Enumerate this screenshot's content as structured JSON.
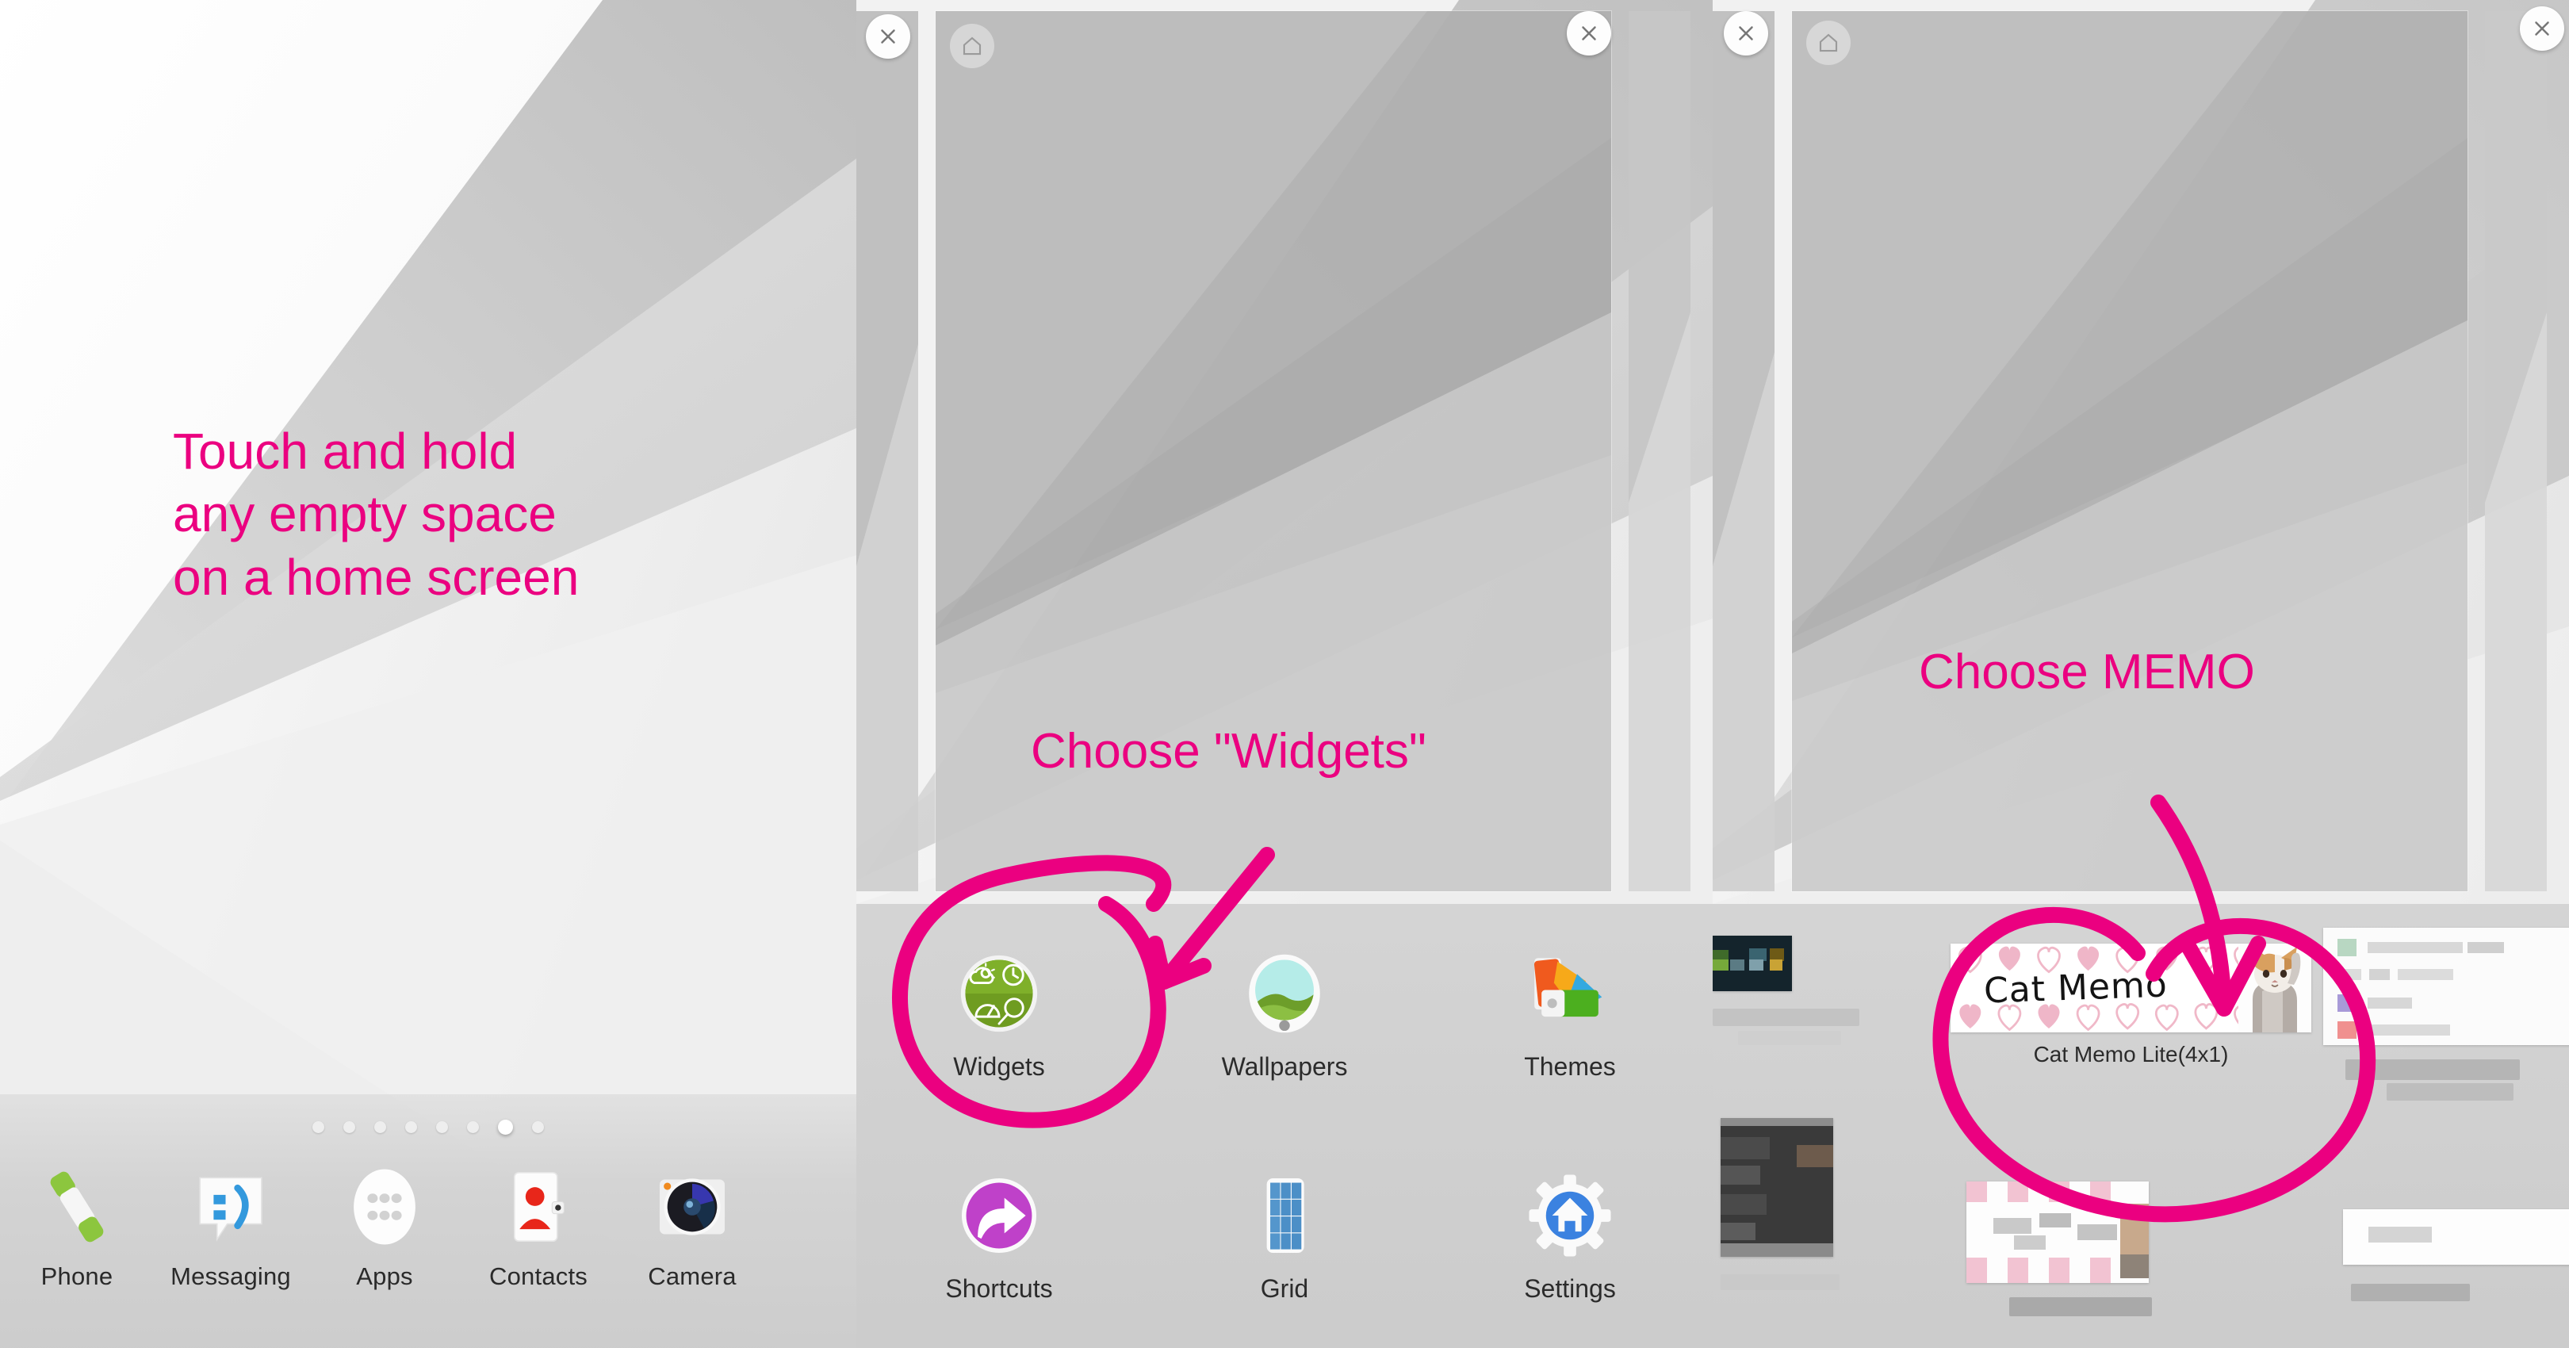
{
  "meta": {
    "accent_pink": "#EB0080",
    "screen_bg": "#e9e9e9"
  },
  "annotations": [
    {
      "id": "touch-and-hold",
      "text": "Touch and hold\nany empty space\non a home screen"
    },
    {
      "id": "choose-widgets",
      "text": "Choose \"Widgets\""
    },
    {
      "id": "choose-memo",
      "text": "Choose MEMO"
    }
  ],
  "panel_home": {
    "page_dots": {
      "count": 8,
      "active_index": 6
    },
    "dock": [
      {
        "label": "Phone",
        "icon": "phone-icon"
      },
      {
        "label": "Messaging",
        "icon": "messaging-icon"
      },
      {
        "label": "Apps",
        "icon": "apps-grid-icon"
      },
      {
        "label": "Contacts",
        "icon": "contacts-icon"
      },
      {
        "label": "Camera",
        "icon": "camera-icon"
      }
    ]
  },
  "panel_editor": {
    "close_label": "x",
    "home_badge_label": "home-icon",
    "menu": [
      {
        "label": "Widgets",
        "icon": "widgets-icon",
        "highlighted": true
      },
      {
        "label": "Wallpapers",
        "icon": "wallpapers-icon",
        "highlighted": false
      },
      {
        "label": "Themes",
        "icon": "themes-icon",
        "highlighted": false
      },
      {
        "label": "Shortcuts",
        "icon": "shortcuts-icon",
        "highlighted": false
      },
      {
        "label": "Grid",
        "icon": "grid-icon",
        "highlighted": false
      },
      {
        "label": "Settings",
        "icon": "settings-home-icon",
        "highlighted": false
      }
    ]
  },
  "panel_picker": {
    "featured_widget": {
      "title": "Cat Memo",
      "name": "Cat Memo Lite(4x1)",
      "highlighted": true
    },
    "other_widgets": [
      {
        "name": "",
        "obscured": true
      },
      {
        "name": "",
        "obscured": true
      },
      {
        "name": "",
        "obscured": true
      },
      {
        "name": "",
        "obscured": true
      },
      {
        "name": "",
        "obscured": true
      },
      {
        "name": "",
        "obscured": true
      }
    ]
  }
}
